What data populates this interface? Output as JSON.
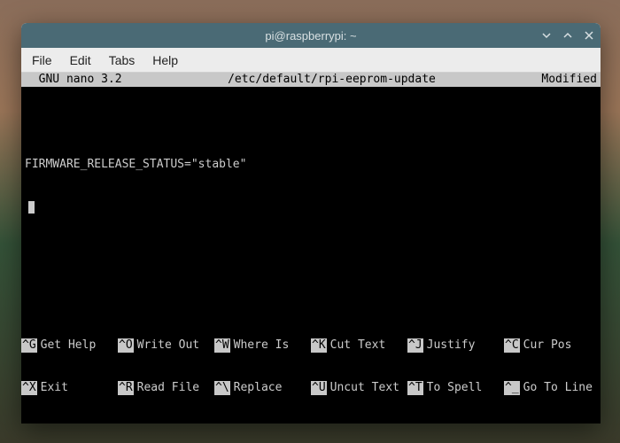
{
  "titlebar": {
    "title": "pi@raspberrypi: ~"
  },
  "menubar": {
    "file": "File",
    "edit": "Edit",
    "tabs": "Tabs",
    "help": "Help"
  },
  "nano": {
    "header": {
      "left": "  GNU nano 3.2",
      "center": "/etc/default/rpi-eeprom-update",
      "right": "Modified"
    },
    "body": {
      "line1": "FIRMWARE_RELEASE_STATUS=\"stable\""
    },
    "footer": {
      "r1c1k": "^G",
      "r1c1t": "Get Help",
      "r1c2k": "^O",
      "r1c2t": "Write Out",
      "r1c3k": "^W",
      "r1c3t": "Where Is",
      "r1c4k": "^K",
      "r1c4t": "Cut Text",
      "r1c5k": "^J",
      "r1c5t": "Justify",
      "r1c6k": "^C",
      "r1c6t": "Cur Pos",
      "r2c1k": "^X",
      "r2c1t": "Exit",
      "r2c2k": "^R",
      "r2c2t": "Read File",
      "r2c3k": "^\\",
      "r2c3t": "Replace",
      "r2c4k": "^U",
      "r2c4t": "Uncut Text",
      "r2c5k": "^T",
      "r2c5t": "To Spell",
      "r2c6k": "^_",
      "r2c6t": "Go To Line"
    }
  }
}
